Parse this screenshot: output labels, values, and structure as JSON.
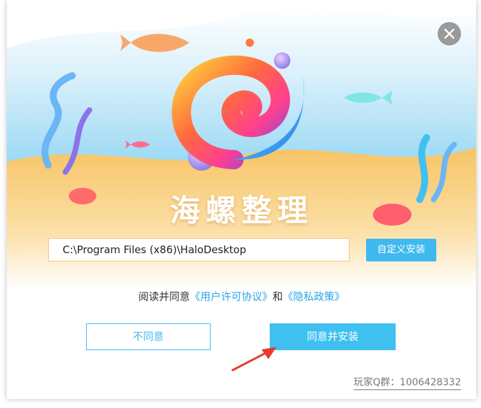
{
  "app": {
    "title": "海螺整理"
  },
  "install": {
    "path_value": "C:\\Program Files (x86)\\HaloDesktop",
    "custom_install_label": "自定义安装"
  },
  "agreement": {
    "prefix": "阅读并同意",
    "license_link": "《用户许可协议》",
    "and_text": "和",
    "privacy_link": "《隐私政策》"
  },
  "buttons": {
    "disagree": "不同意",
    "agree_install": "同意并安装"
  },
  "footer": {
    "qq_group": "玩家Q群：1006428332"
  },
  "colors": {
    "accent": "#3fb9ee",
    "sky_top": "#eaf6fd",
    "sky_bottom": "#8ed6f5",
    "sand": "#f6c35f",
    "arrow": "#e53b2c"
  },
  "icons": [
    "close-icon",
    "app-logo-icon",
    "pointer-arrow-icon"
  ]
}
